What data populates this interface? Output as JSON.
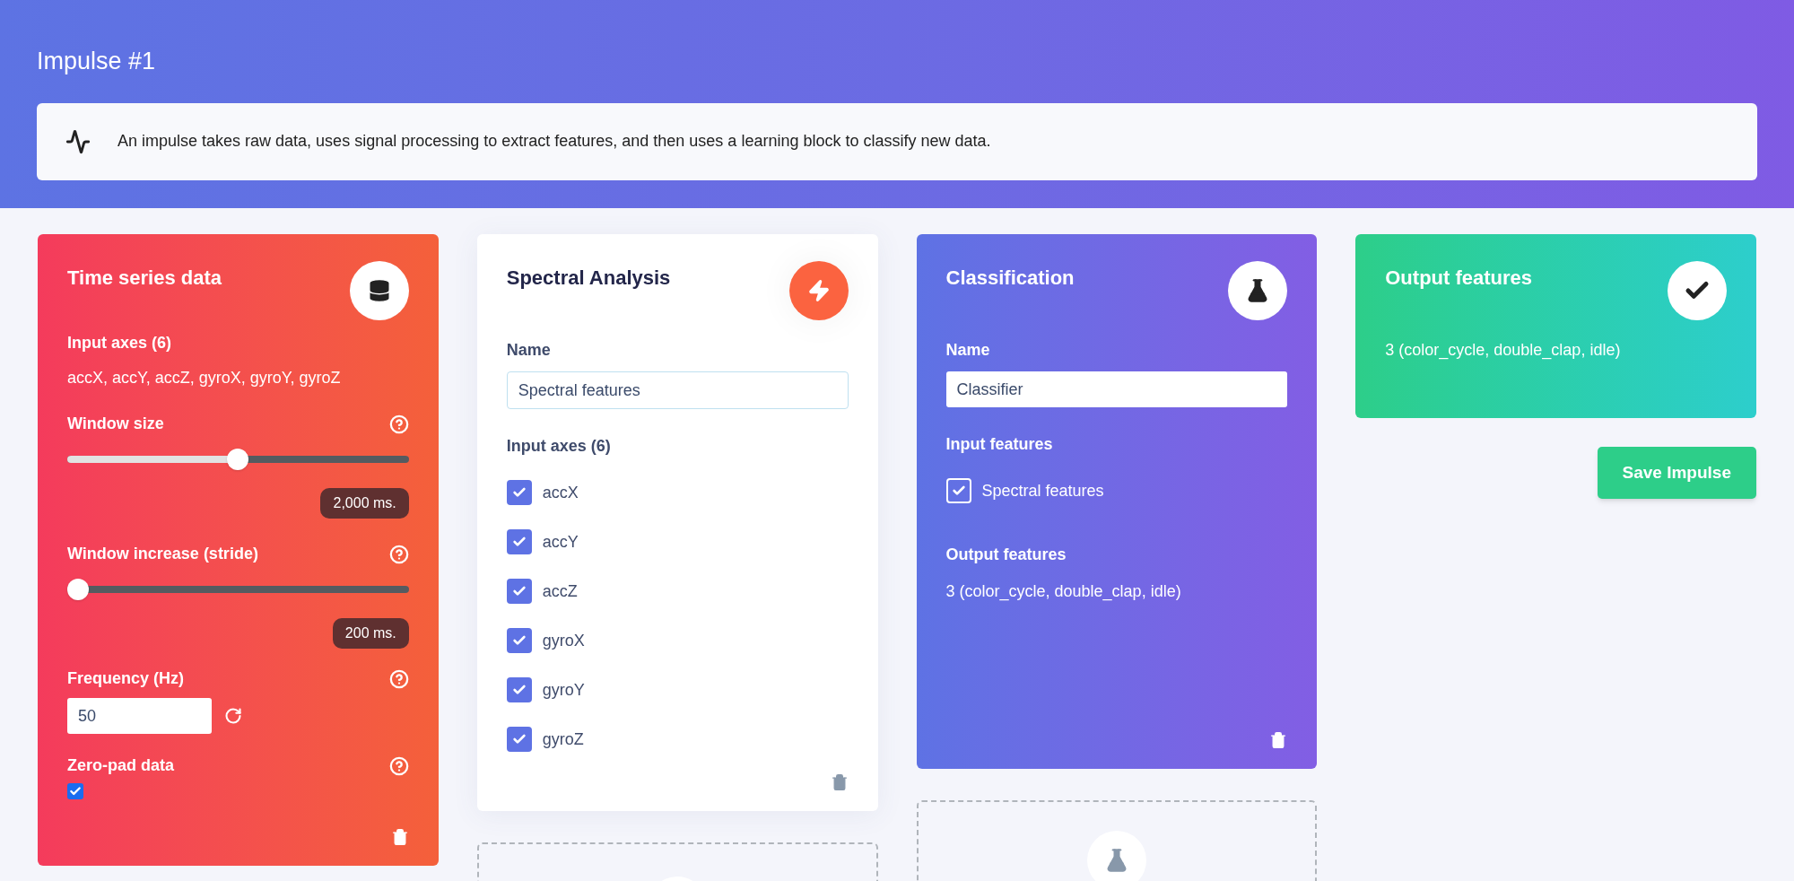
{
  "page": {
    "title": "Impulse #1"
  },
  "info": {
    "text": "An impulse takes raw data, uses signal processing to extract features, and then uses a learning block to classify new data."
  },
  "time_series": {
    "title": "Time series data",
    "axes_label": "Input axes (6)",
    "axes": "accX, accY, accZ, gyroX, gyroY, gyroZ",
    "sliders": [
      {
        "label": "Window size",
        "level": 0.5,
        "reading": "2,000 ms."
      },
      {
        "label": "Window increase (stride)",
        "level": 0.0,
        "reading": "200 ms."
      }
    ],
    "frequency": {
      "label": "Frequency (Hz)",
      "value": "50"
    },
    "zero_pad": {
      "label": "Zero-pad data",
      "checked": true
    }
  },
  "processing": {
    "title": "Spectral Analysis",
    "name_label": "Name",
    "name_value": "Spectral features",
    "axes_label": "Input axes (6)",
    "axes": [
      {
        "label": "accX",
        "checked": true
      },
      {
        "label": "accY",
        "checked": true
      },
      {
        "label": "accZ",
        "checked": true
      },
      {
        "label": "gyroX",
        "checked": true
      },
      {
        "label": "gyroY",
        "checked": true
      },
      {
        "label": "gyroZ",
        "checked": true
      }
    ]
  },
  "learning": {
    "title": "Classification",
    "name_label": "Name",
    "name_value": "Classifier",
    "input_label": "Input features",
    "inputs": [
      {
        "label": "Spectral features",
        "checked": true
      }
    ],
    "output_label": "Output features",
    "output_value": "3 (color_cycle, double_clap, idle)"
  },
  "output": {
    "title": "Output features",
    "value": "3 (color_cycle, double_clap, idle)"
  },
  "save_button": "Save Impulse"
}
